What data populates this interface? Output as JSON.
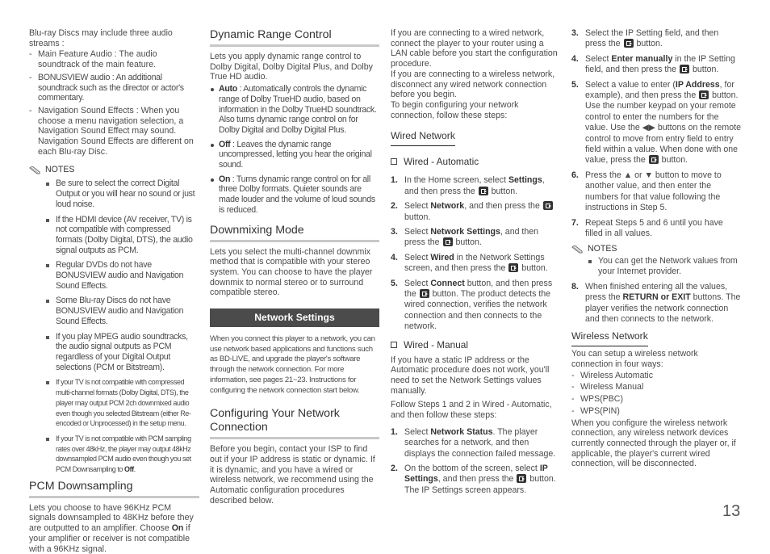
{
  "col1": {
    "intro": "Blu-ray Discs may include three audio streams :",
    "streams": [
      "Main Feature Audio : The audio soundtrack of the main feature.",
      "BONUSVIEW audio : An additional soundtrack such as the director or actor's commentary.",
      "Navigation Sound Effects : When you choose a menu navigation selection, a Navigation Sound Effect may sound. Navigation Sound Effects are different on each Blu-ray Disc."
    ],
    "notes_label": "NOTES",
    "notes": [
      "Be sure to select the correct Digital Output or you will hear no sound or just loud noise.",
      "If the HDMI device (AV receiver, TV) is not compatible with compressed formats (Dolby Digital, DTS), the audio signal outputs as PCM.",
      "Regular DVDs do not have BONUSVIEW audio and Navigation Sound Effects.",
      "Some Blu-ray Discs do not have BONUSVIEW audio and Navigation Sound Effects.",
      "If you play MPEG audio soundtracks, the audio signal outputs as PCM regardless of your Digital Output selections (PCM or Bitstream).",
      "If your TV is not compatible with compressed multi-channel formats (Dolby Digital, DTS), the player may output PCM 2ch downmixed audio even though you selected Bitstream (either Re-encoded or Unprocessed) in the setup menu."
    ],
    "note_last_pre": "If your TV is not compatible with PCM sampling rates over 48kHz, the player may output 48kHz downsampled PCM audio even though you set PCM Downsampling to ",
    "note_last_bold": "Off",
    "note_last_post": ".",
    "pcm_title": "PCM Downsampling",
    "pcm_pre": "Lets you choose to have 96KHz PCM signals downsampled to 48KHz before they are outputted to an amplifier. Choose ",
    "pcm_bold": "On",
    "pcm_post": " if your amplifier or receiver is not compatible with a 96KHz signal."
  },
  "col2": {
    "drc_title": "Dynamic Range Control",
    "drc_intro": "Lets you apply dynamic range control to Dolby Digital, Dolby Digital Plus, and Dolby True HD audio.",
    "drc_options": [
      {
        "label": "Auto",
        "text": " : Automatically controls the dynamic range of Dolby TrueHD audio, based on information in the Dolby TrueHD soundtrack. Also turns dynamic range control on for Dolby Digital and Dolby Digital Plus."
      },
      {
        "label": "Off",
        "text": " : Leaves the dynamic range uncompressed, letting you hear the original sound."
      },
      {
        "label": "On",
        "text": " : Turns dynamic range control on for all three Dolby formats. Quieter sounds are made louder and the volume of loud sounds is reduced."
      }
    ],
    "downmix_title": "Downmixing Mode",
    "downmix_text": "Lets you select the multi-channel downmix method that is compatible with your stereo system. You can choose to have the player downmix to normal stereo or to surround compatible stereo.",
    "banner": "Network Settings",
    "network_intro": "When you connect this player to a network, you can use network based applications and functions such as BD-LIVE, and upgrade the player's software through the network connection. For more information, see pages 21~23. Instructions for configuring the network connection start below.",
    "config_title": "Configuring Your Network Connection",
    "config_text": "Before you begin, contact your ISP to find out if your IP address is static or dynamic. If it is dynamic, and you have a wired or wireless network, we recommend using the Automatic configuration procedures described below."
  },
  "col3": {
    "intro1": "If you are connecting to a wired network, connect the player to your router using a LAN cable before you start the configuration procedure.",
    "intro2": "If you are connecting to a wireless network, disconnect any wired network connection before you begin.",
    "intro3": "To begin configuring your network connection, follow these steps:",
    "wired_title": "Wired Network",
    "auto_title": "Wired - Automatic",
    "auto_steps": [
      {
        "num": "1.",
        "a": "In the Home screen, select ",
        "b": "Settings",
        "c": ", and then press the ",
        "d": " button."
      },
      {
        "num": "2.",
        "a": "Select ",
        "b": "Network",
        "c": ", and then press the ",
        "d": " button."
      },
      {
        "num": "3.",
        "a": "Select ",
        "b": "Network Settings",
        "c": ", and then press the ",
        "d": " button."
      },
      {
        "num": "4.",
        "a": "Select ",
        "b": "Wired",
        "c": " in the Network Settings screen, and then press the ",
        "d": " button."
      },
      {
        "num": "5.",
        "a": "Select ",
        "b": "Connect",
        "c": " button, and then press the ",
        "d": " button. The product detects the wired connection, verifies the network connection and then connects to the network."
      }
    ],
    "manual_title": "Wired - Manual",
    "manual_intro": "If you have a static IP address or the Automatic procedure does not work, you'll need to set the Network Settings values manually.",
    "manual_follow": "Follow Steps 1 and 2 in Wired - Automatic, and then follow these steps:",
    "manual_steps": [
      {
        "num": "1.",
        "a": "Select ",
        "b": "Network Status",
        "c": ". The player searches for a network, and then displays the connection failed message.",
        "d": ""
      },
      {
        "num": "2.",
        "a": "On the bottom of the screen, select ",
        "b": "IP Settings",
        "c": ", and then press the ",
        "d": " button. The IP Settings screen appears."
      }
    ]
  },
  "col4": {
    "steps": [
      {
        "num": "3.",
        "a": "Select the IP Setting field, and then press the ",
        "b": "",
        "c": "",
        "d": " button."
      },
      {
        "num": "4.",
        "a": "Select ",
        "b": "Enter manually",
        "c": " in the IP Setting field, and then press the ",
        "d": " button."
      }
    ],
    "step5": {
      "num": "5.",
      "a": "Select a value to enter (",
      "b": "IP Address",
      "c": ", for example), and then press the ",
      "d": " button. Use the number keypad on your remote control to enter the numbers for the value.  Use the ◀▶ buttons on the remote control to move from entry field to entry field within a value. When done with one value, press the ",
      "e": " button."
    },
    "step6": {
      "num": "6.",
      "text": "Press the ▲ or ▼ button to move to another value, and then enter the numbers for that value following the instructions in Step 5."
    },
    "step7": {
      "num": "7.",
      "text": "Repeat Steps 5 and 6 until you have filled in all values."
    },
    "notes_label": "NOTES",
    "notes": [
      "You can get the Network values from your Internet provider."
    ],
    "step8": {
      "num": "8.",
      "a": "When finished entering all the values, press the ",
      "b": "RETURN or EXIT",
      "c": " buttons. The player verifies the network connection and then connects to the network."
    },
    "wireless_title": "Wireless Network",
    "wireless_intro": "You can setup a wireless network connection in four ways:",
    "wireless_ways": [
      "Wireless Automatic",
      "Wireless Manual",
      "WPS(PBC)",
      "WPS(PIN)"
    ],
    "wireless_outro": "When you configure the wireless network connection, any wireless network devices currently connected through the player or, if applicable, the player's current wired connection, will be disconnected."
  },
  "page_number": "13"
}
